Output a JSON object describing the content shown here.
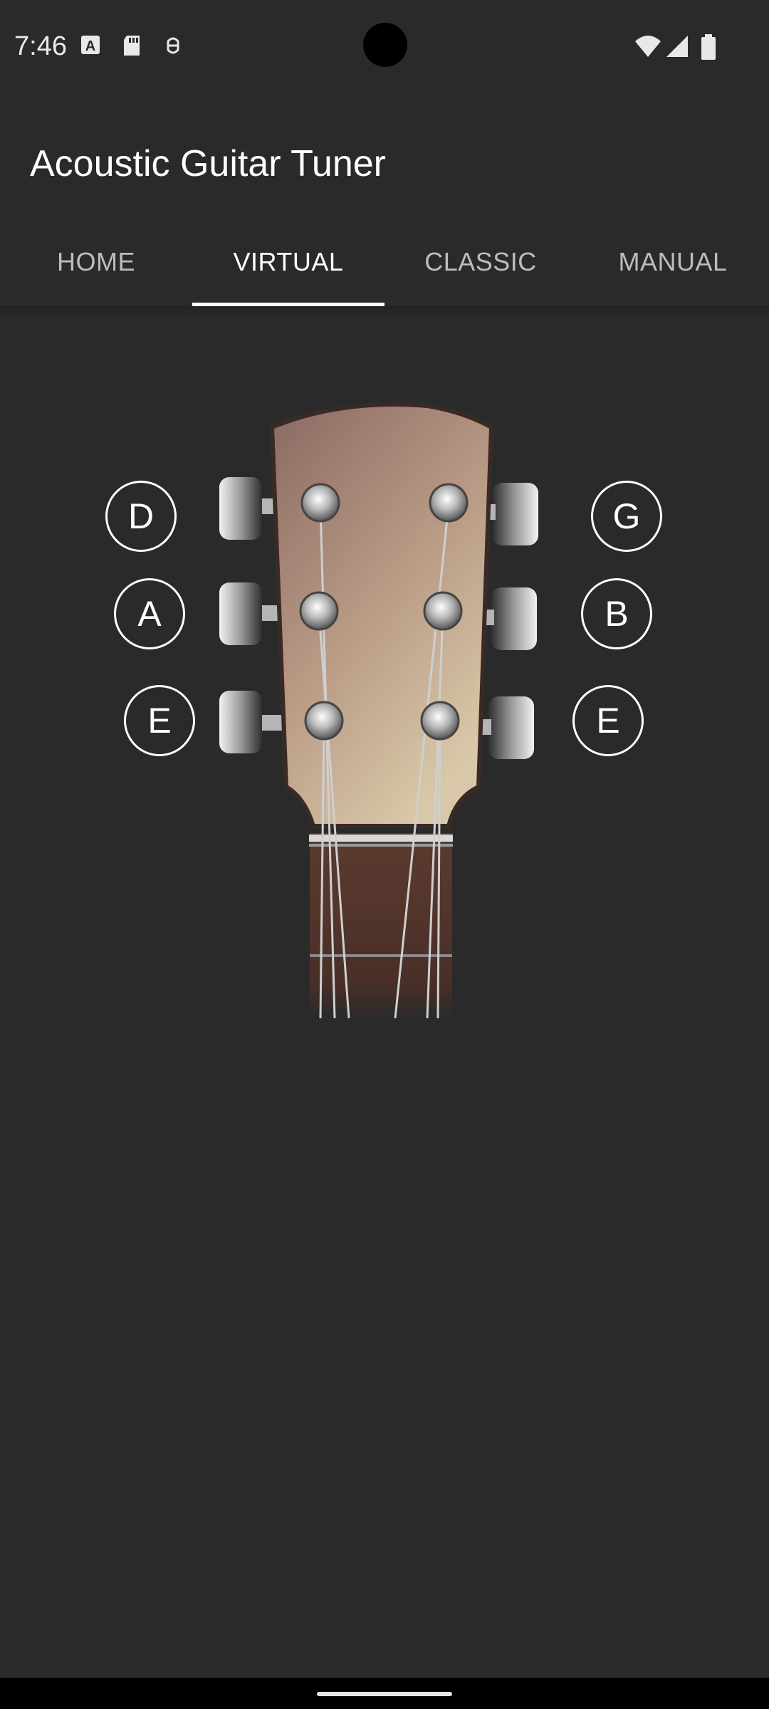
{
  "status_bar": {
    "time": "7:46",
    "left_icons": [
      "a-notification-icon",
      "sd-card-icon",
      "debug-icon"
    ],
    "right_icons": [
      "wifi-icon",
      "signal-icon",
      "battery-icon"
    ]
  },
  "app_bar": {
    "title": "Acoustic Guitar Tuner"
  },
  "tabs": [
    {
      "label": "HOME",
      "active": false
    },
    {
      "label": "VIRTUAL",
      "active": true
    },
    {
      "label": "CLASSIC",
      "active": false
    },
    {
      "label": "MANUAL",
      "active": false
    }
  ],
  "tuner": {
    "left_notes": [
      "D",
      "A",
      "E"
    ],
    "right_notes": [
      "G",
      "B",
      "E"
    ]
  },
  "colors": {
    "background": "#2a2a2a",
    "accent": "#ffffff",
    "inactive_tab": "#bdbdbd"
  }
}
